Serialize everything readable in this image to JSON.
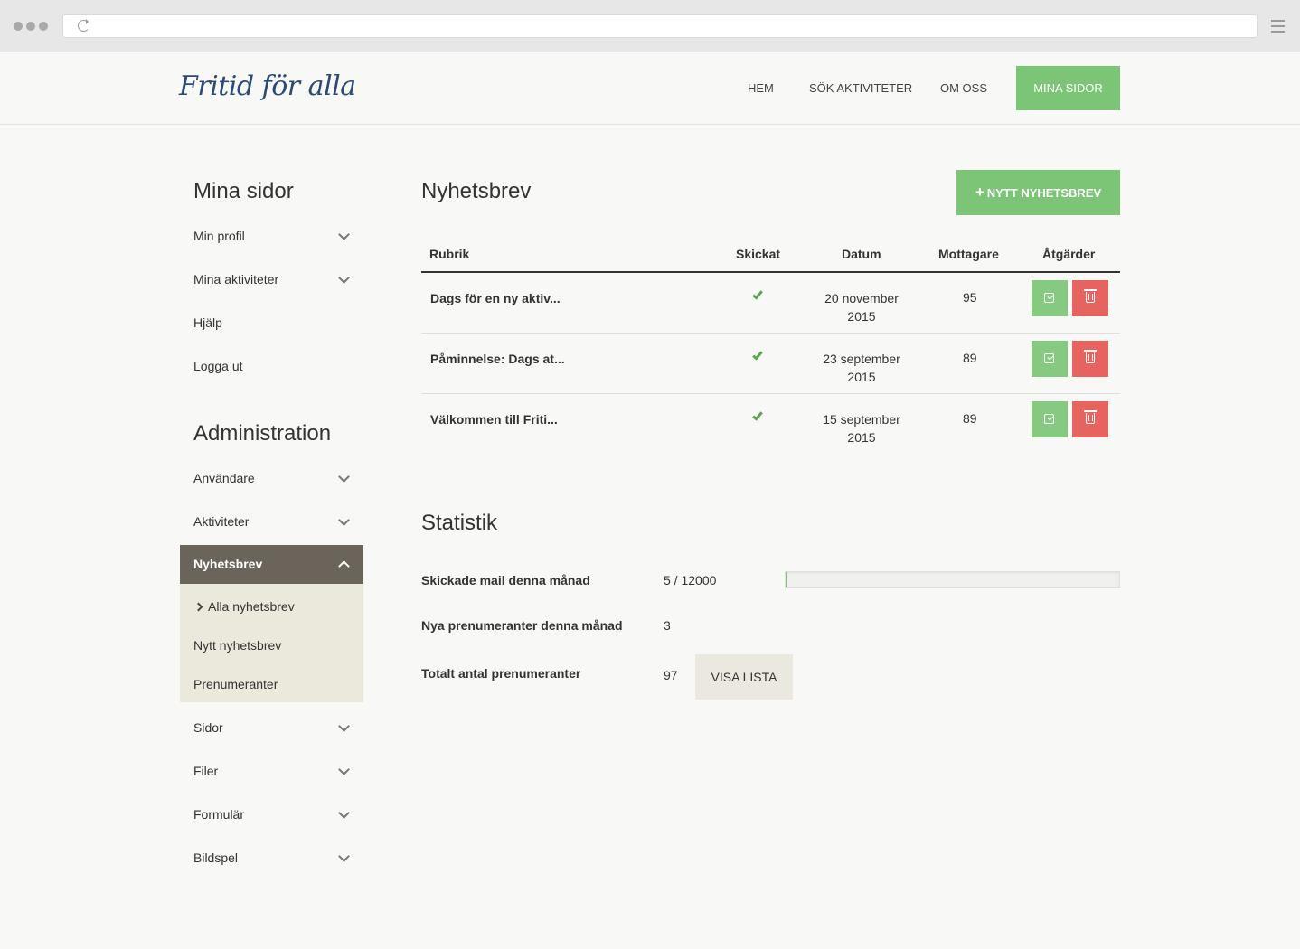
{
  "header": {
    "logo_text": "Fritid för alla",
    "nav": [
      "HEM",
      "SÖK AKTIVITETER",
      "OM OSS"
    ],
    "nav_cta": "MINA SIDOR"
  },
  "sidebar": {
    "section1_title": "Mina sidor",
    "section1_items": [
      "Min profil",
      "Mina aktiviteter",
      "Hjälp",
      "Logga ut"
    ],
    "section2_title": "Administration",
    "section2_items": [
      "Användare",
      "Aktiviteter"
    ],
    "active_item": "Nyhetsbrev",
    "submenu": [
      "Alla nyhetsbrev",
      "Nytt nyhetsbrev",
      "Prenumeranter"
    ],
    "section2_items_after": [
      "Sidor",
      "Filer",
      "Formulär",
      "Bildspel"
    ]
  },
  "main": {
    "title": "Nyhetsbrev",
    "new_button": "NYTT NYHETSBREV",
    "table": {
      "headers": [
        "Rubrik",
        "Skickat",
        "Datum",
        "Mottagare",
        "Åtgärder"
      ],
      "rows": [
        {
          "title": "Dags för en ny aktiv...",
          "sent": true,
          "date_line1": "20 november",
          "date_line2": "2015",
          "recipients": "95"
        },
        {
          "title": "Påminnelse: Dags at...",
          "sent": true,
          "date_line1": "23 september",
          "date_line2": "2015",
          "recipients": "89"
        },
        {
          "title": "Välkommen till Friti...",
          "sent": true,
          "date_line1": "15 september",
          "date_line2": "2015",
          "recipients": "89"
        }
      ]
    },
    "stats_title": "Statistik",
    "stats": {
      "sent_label": "Skickade mail denna månad",
      "sent_value": "5 / 12000",
      "sent_fraction": 0.0004,
      "new_label": "Nya prenumeranter denna månad",
      "new_value": "3",
      "total_label": "Totalt antal prenumeranter",
      "total_value": "97",
      "list_button": "VISA LISTA"
    }
  },
  "colors": {
    "accent_green": "#7cc576",
    "delete_red": "#e7635f",
    "active_nav": "#6a645a",
    "submenu_bg": "#ebe8dc"
  }
}
